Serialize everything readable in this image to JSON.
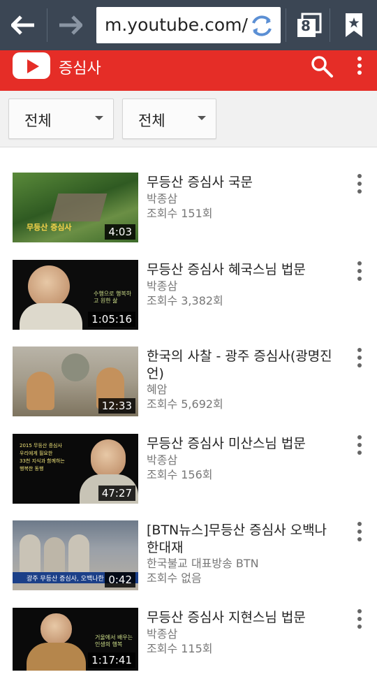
{
  "browser": {
    "url": "m.youtube.com/",
    "tab_count": "8"
  },
  "header": {
    "title": "증심사"
  },
  "filters": {
    "first": "전체",
    "second": "전체"
  },
  "videos": [
    {
      "title": "무등산 증심사 국문",
      "channel": "박종삼",
      "views": "조회수 151회",
      "duration": "4:03"
    },
    {
      "title": "무등산 증심사 혜국스님 법문",
      "channel": "박종삼",
      "views": "조회수 3,382회",
      "duration": "1:05:16"
    },
    {
      "title": "한국의 사찰 - 광주 증심사(광명진언)",
      "channel": "혜암",
      "views": "조회수 5,692회",
      "duration": "12:33"
    },
    {
      "title": "무등산 증심사 미산스님 법문",
      "channel": "박종삼",
      "views": "조회수 156회",
      "duration": "47:27"
    },
    {
      "title": "[BTN뉴스]무등산 증심사 오백나한대재",
      "channel": "한국불교 대표방송 BTN",
      "views": "조회수 없음",
      "duration": "0:42"
    },
    {
      "title": "무등산 증심사 지현스님 법문",
      "channel": "박종삼",
      "views": "조회수 115회",
      "duration": "1:17:41"
    }
  ],
  "colors": {
    "browser_bar": "#3b4654",
    "brand": "#e52d27"
  },
  "icons": [
    "back-arrow-icon",
    "forward-arrow-icon",
    "reload-icon",
    "tabs-icon",
    "bookmark-icon",
    "youtube-logo-icon",
    "search-icon",
    "more-vert-icon"
  ]
}
